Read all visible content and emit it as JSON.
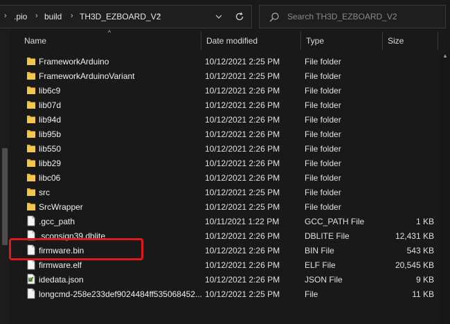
{
  "breadcrumb": {
    "items": [
      ".pio",
      "build",
      "TH3D_EZBOARD_V2"
    ]
  },
  "search": {
    "placeholder": "Search TH3D_EZBOARD_V2"
  },
  "columns": {
    "name": "Name",
    "date": "Date modified",
    "type": "Type",
    "size": "Size"
  },
  "files": [
    {
      "name": "FrameworkArduino",
      "date": "10/12/2021 2:25 PM",
      "type": "File folder",
      "size": "",
      "icon": "folder-icon"
    },
    {
      "name": "FrameworkArduinoVariant",
      "date": "10/12/2021 2:25 PM",
      "type": "File folder",
      "size": "",
      "icon": "folder-icon"
    },
    {
      "name": "lib6c9",
      "date": "10/12/2021 2:26 PM",
      "type": "File folder",
      "size": "",
      "icon": "folder-icon"
    },
    {
      "name": "lib07d",
      "date": "10/12/2021 2:26 PM",
      "type": "File folder",
      "size": "",
      "icon": "folder-icon"
    },
    {
      "name": "lib94d",
      "date": "10/12/2021 2:26 PM",
      "type": "File folder",
      "size": "",
      "icon": "folder-icon"
    },
    {
      "name": "lib95b",
      "date": "10/12/2021 2:26 PM",
      "type": "File folder",
      "size": "",
      "icon": "folder-icon"
    },
    {
      "name": "lib550",
      "date": "10/12/2021 2:26 PM",
      "type": "File folder",
      "size": "",
      "icon": "folder-icon"
    },
    {
      "name": "libb29",
      "date": "10/12/2021 2:26 PM",
      "type": "File folder",
      "size": "",
      "icon": "folder-icon"
    },
    {
      "name": "libc06",
      "date": "10/12/2021 2:26 PM",
      "type": "File folder",
      "size": "",
      "icon": "folder-icon"
    },
    {
      "name": "src",
      "date": "10/12/2021 2:25 PM",
      "type": "File folder",
      "size": "",
      "icon": "folder-icon"
    },
    {
      "name": "SrcWrapper",
      "date": "10/12/2021 2:25 PM",
      "type": "File folder",
      "size": "",
      "icon": "folder-icon"
    },
    {
      "name": ".gcc_path",
      "date": "10/11/2021 1:22 PM",
      "type": "GCC_PATH File",
      "size": "1 KB",
      "icon": "file-icon"
    },
    {
      "name": ".sconsign39.dblite",
      "date": "10/12/2021 2:26 PM",
      "type": "DBLITE File",
      "size": "12,431 KB",
      "icon": "file-icon"
    },
    {
      "name": "firmware.bin",
      "date": "10/12/2021 2:26 PM",
      "type": "BIN File",
      "size": "543 KB",
      "icon": "file-icon"
    },
    {
      "name": "firmware.elf",
      "date": "10/12/2021 2:26 PM",
      "type": "ELF File",
      "size": "20,545 KB",
      "icon": "file-icon"
    },
    {
      "name": "idedata.json",
      "date": "10/12/2021 2:26 PM",
      "type": "JSON File",
      "size": "9 KB",
      "icon": "json-file-icon"
    },
    {
      "name": "longcmd-258e233def9024484ff535068452...",
      "date": "10/12/2021 2:25 PM",
      "type": "File",
      "size": "11 KB",
      "icon": "file-icon"
    }
  ],
  "colors": {
    "background": "#191919",
    "folder": "#e8b53a",
    "highlight": "#e01818"
  }
}
